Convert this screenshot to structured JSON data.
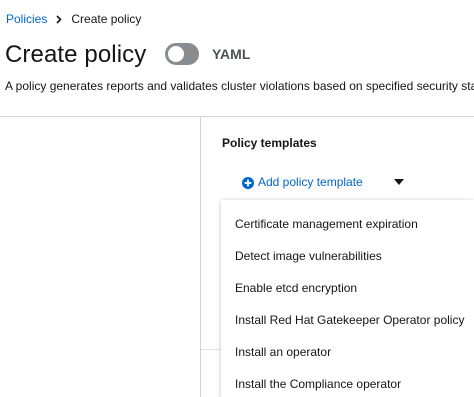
{
  "breadcrumb": {
    "parent": "Policies",
    "current": "Create policy",
    "separator_icon": "chevron-right-icon"
  },
  "header": {
    "title": "Create policy",
    "yaml_toggle_label": "YAML",
    "yaml_toggle_on": false
  },
  "description": "A policy generates reports and validates cluster violations based on specified security standards, categories, and controls.",
  "policy_templates": {
    "title": "Policy templates",
    "add_button_label": "Add policy template",
    "add_icon": "plus-circle-icon",
    "caret_icon": "caret-down-icon",
    "menu_items": [
      "Certificate management expiration",
      "Detect image vulnerabilities",
      "Enable etcd encryption",
      "Install Red Hat Gatekeeper Operator policy",
      "Install an operator",
      "Install the Compliance operator"
    ]
  },
  "colors": {
    "link": "#0066cc",
    "text": "#151515",
    "toggle_off": "#8a8d90",
    "divider": "#d2d2d2"
  }
}
